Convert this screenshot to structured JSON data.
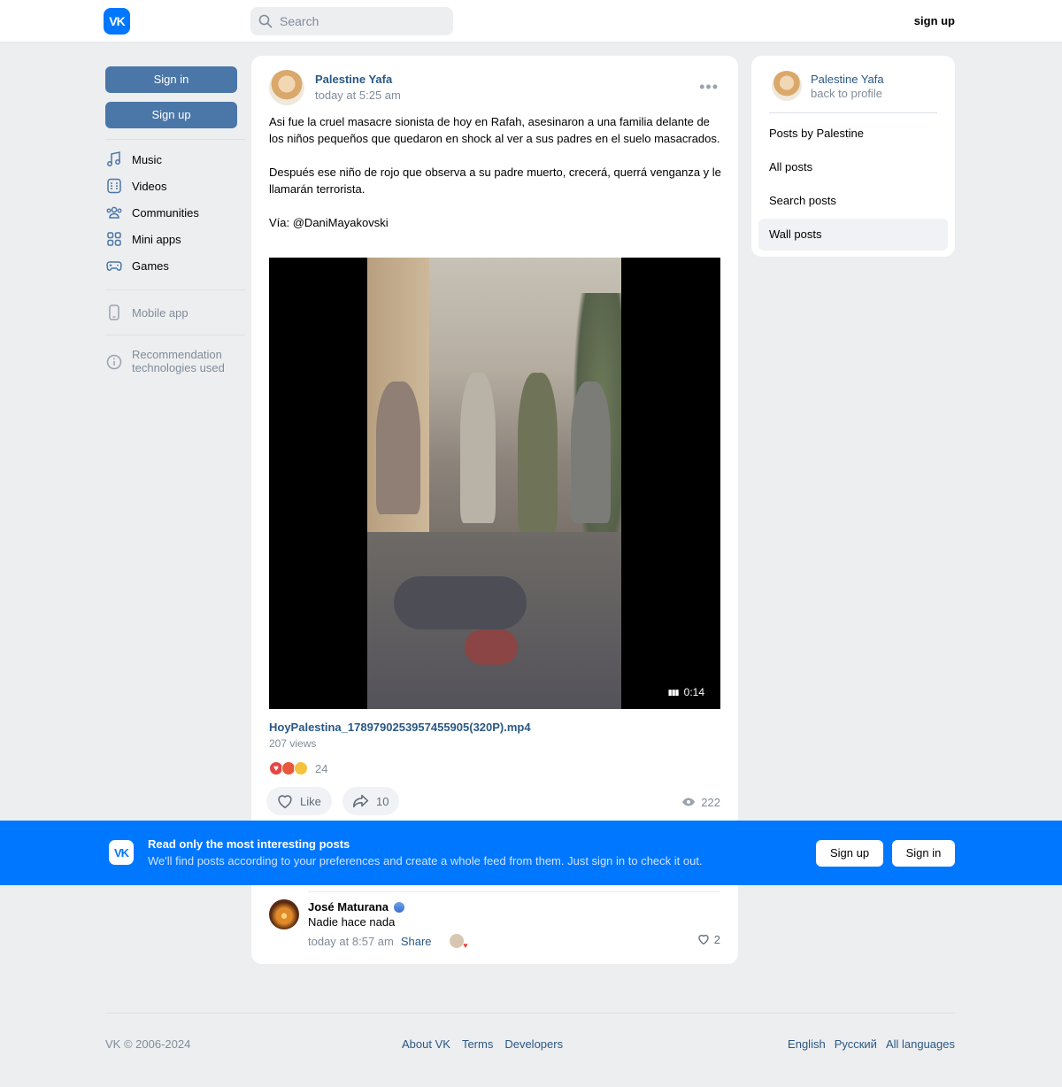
{
  "topbar": {
    "logo": "VK",
    "search_placeholder": "Search",
    "signup": "sign up"
  },
  "leftnav": {
    "sign_in": "Sign in",
    "sign_up": "Sign up",
    "items": [
      {
        "label": "Music",
        "icon": "music-icon"
      },
      {
        "label": "Videos",
        "icon": "video-icon"
      },
      {
        "label": "Communities",
        "icon": "communities-icon"
      },
      {
        "label": "Mini apps",
        "icon": "mini-apps-icon"
      },
      {
        "label": "Games",
        "icon": "gamepad-icon"
      }
    ],
    "mobile_app": "Mobile app",
    "recommendation": "Recommendation technologies used"
  },
  "post": {
    "author": "Palestine Yafa",
    "time": "today at 5:25 am",
    "text": "Asi fue la cruel masacre sionista de hoy en Rafah, asesinaron a una familia delante de los niños pequeños que quedaron en shock al ver a sus padres en el suelo masacrados.\n\nDespués ese niño de rojo que observa a su padre muerto, crecerá, querrá venganza y le llamarán terrorista.\n\nVía: @DaniMayakovski",
    "video_duration": "0:14",
    "file_name": "HoyPalestina_1789790253957455905(320P).mp4",
    "file_views": "207 views",
    "reactions_count": "24",
    "like_label": "Like",
    "share_count": "10",
    "views": "222"
  },
  "comment": {
    "author": "José Maturana",
    "text": "Nadie hace nada",
    "time": "today at 8:57 am",
    "share": "Share",
    "likes": "2"
  },
  "rightcard": {
    "name": "Palestine Yafa",
    "back": "back to profile",
    "items": [
      "Posts by Palestine",
      "All posts",
      "Search posts",
      "Wall posts"
    ],
    "active_index": 3
  },
  "banner": {
    "title": "Read only the most interesting posts",
    "subtitle": "We'll find posts according to your preferences and create a whole feed from them. Just sign in to check it out.",
    "sign_up": "Sign up",
    "sign_in": "Sign in",
    "color": "#0077ff"
  },
  "footer": {
    "copyright": "VK © 2006-2024",
    "links": [
      "About VK",
      "Terms",
      "Developers"
    ],
    "languages": [
      "English",
      "Русский",
      "All languages"
    ]
  }
}
